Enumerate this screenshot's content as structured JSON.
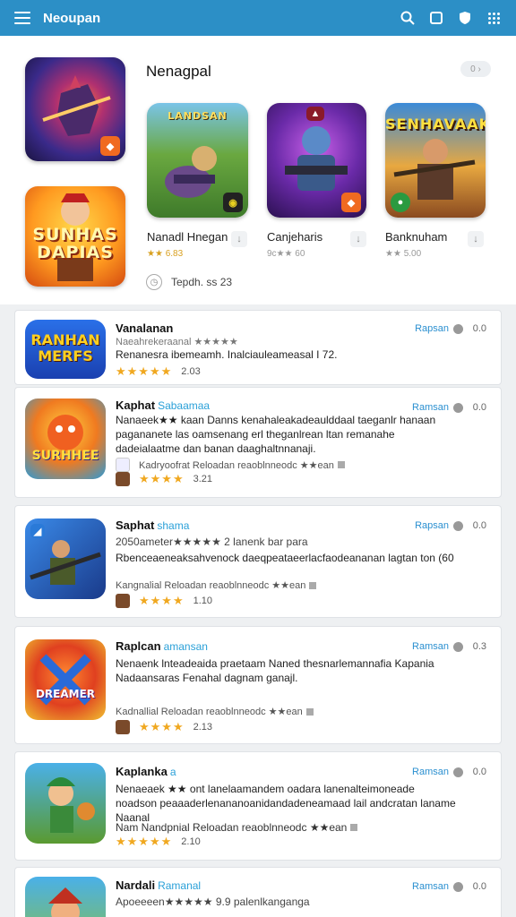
{
  "app": {
    "title": "Neoupan"
  },
  "header_icons": [
    "search-icon",
    "bookmark-icon",
    "shield-icon",
    "grid-icon"
  ],
  "featured": {
    "section_title": "Nenagpal",
    "more_label": "0",
    "side_art": [
      {
        "label": ""
      },
      {
        "label": "SUNHAS DAPIAS"
      }
    ],
    "games": [
      {
        "name": "Nanadl Hnegan",
        "rating": "★★ 6.83",
        "art_label": "LANDSAN"
      },
      {
        "name": "Canjeharis",
        "rating": "9c★★ 60",
        "art_label": ""
      },
      {
        "name": "Banknuham",
        "rating": "★★ 5.00",
        "art_label": "SENHAVAAK"
      }
    ],
    "updated_label": "Tepdh. ss 23"
  },
  "apps": [
    {
      "name": "Vanalanan",
      "tag": "",
      "action": "Rapsan",
      "count": "0.0",
      "subtitle": "Naeahrekeraanal ★★★★★",
      "description": "Renanesra ibemeamh. Inalciauleameasal I 72.",
      "developer": "",
      "stars": "★★★★★",
      "rating": "2.03",
      "icon_label": "RANHAN MERFS"
    },
    {
      "name": "Kaphat",
      "tag": "Sabaamaa",
      "action": "Ramsan",
      "count": "0.0",
      "subtitle": "",
      "description": "Nanaeek★★ kaan Danns kenahaleakadeaulddaal taeganlr hanaan pagananete las oamsenang erl theganlrean ltan remanahe dadeialaatme dan banan daaghaltnnanaji.",
      "developer": "Kadryoofrat Reloadan reaoblnneodc ★★ean",
      "stars": "★★★★",
      "rating": "3.21",
      "icon_label": "SURHHEE"
    },
    {
      "name": "Saphat",
      "tag": "shama",
      "action": "Rapsan",
      "count": "0.0",
      "subtitle": "2050ameter★★★★★ 2 lanenk bar para",
      "description": "Rbenceaeneaksahvenock daeqpeataeerlacfaodeananan lagtan ton (60",
      "developer": "Kangnalial Reloadan reaoblnneodc ★★ean",
      "stars": "★★★★",
      "rating": "1.10",
      "icon_label": ""
    },
    {
      "name": "Raplcan",
      "tag": "amansan",
      "action": "Ramsan",
      "count": "0.3",
      "subtitle": "",
      "description": "Nenaenk lnteadeaida praetaam Naned thesnarlemannafia Kapania Nadaansaras Fenahal dagnam ganajl.",
      "developer": "Kadnallial Reloadan reaoblnneodc ★★ean",
      "stars": "★★★★",
      "rating": "2.13",
      "icon_label": "DREAMER"
    },
    {
      "name": "Kaplanka",
      "tag": "a",
      "action": "Ramsan",
      "count": "0.0",
      "subtitle": "",
      "description": "Nenaeaek ★★ ont lanelaamandem oadara lanenalteimoneade noadson peaaaderlenananoanidandadeneamaad lail andcratan laname Naanal",
      "developer": "Nam Nandpnial Reloadan reaoblnneodc ★★ean",
      "stars": "★★★★★",
      "rating": "2.10",
      "icon_label": ""
    },
    {
      "name": "Nardali",
      "tag": "Ramanal",
      "action": "Ramsan",
      "count": "0.0",
      "subtitle": "Apoeeeen★★★★★ 9.9 palenlkanganga",
      "description": "",
      "developer": "",
      "stars": "",
      "rating": "",
      "icon_label": ""
    }
  ],
  "colors": {
    "header": "#2c8fc6",
    "accent": "#2aa0d8",
    "star": "#f0a820"
  }
}
